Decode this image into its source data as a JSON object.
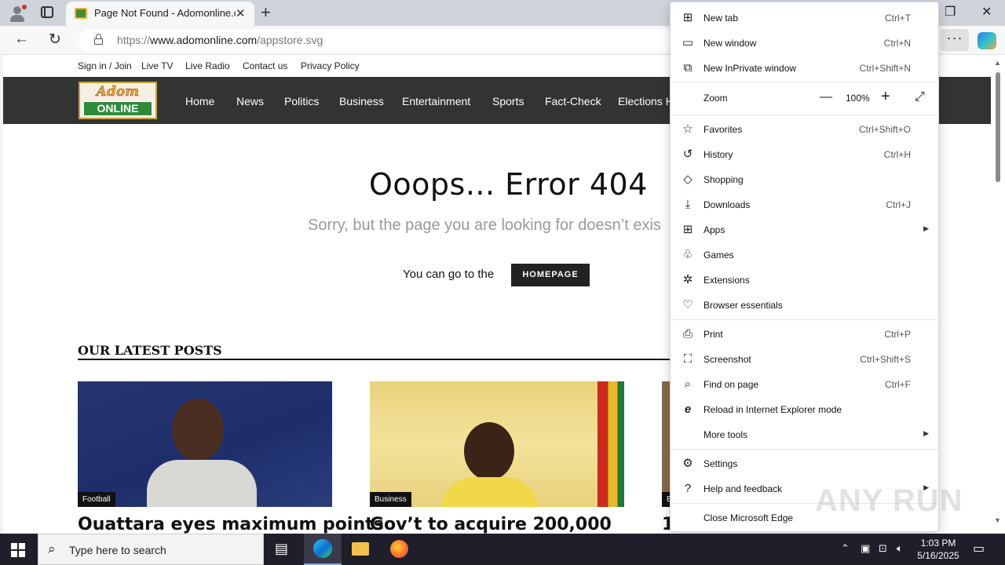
{
  "browser": {
    "tab_title": "Page Not Found - Adomonline.c",
    "url_prefix": "https://",
    "url_host": "www.adomonline.com",
    "url_path": "/appstore.svg"
  },
  "site": {
    "top_links": [
      "Sign in / Join",
      "Live TV",
      "Live Radio",
      "Contact us",
      "Privacy Policy"
    ],
    "logo_top": "Adom",
    "logo_bottom": "ONLINE",
    "nav": [
      "Home",
      "News",
      "Politics",
      "Business",
      "Entertainment",
      "Sports",
      "Fact-Check",
      "Elections H"
    ],
    "error_title": "Ooops... Error 404",
    "error_sub": "Sorry, but the page you are looking for doesn’t exis",
    "goto_text": "You can go to the",
    "homepage_btn": "HOMEPAGE",
    "latest_title": "OUR LATEST POSTS",
    "posts": [
      {
        "category": "Football",
        "title": "Ouattara eyes maximum points"
      },
      {
        "category": "Business",
        "title": "Gov’t to acquire 200,000"
      },
      {
        "category": "B",
        "title": "1"
      }
    ]
  },
  "menu": {
    "items": [
      {
        "label": "New tab",
        "shortcut": "Ctrl+T"
      },
      {
        "label": "New window",
        "shortcut": "Ctrl+N"
      },
      {
        "label": "New InPrivate window",
        "shortcut": "Ctrl+Shift+N"
      },
      {
        "label": "Zoom",
        "shortcut": ""
      },
      {
        "label": "Favorites",
        "shortcut": "Ctrl+Shift+O"
      },
      {
        "label": "History",
        "shortcut": "Ctrl+H"
      },
      {
        "label": "Shopping",
        "shortcut": ""
      },
      {
        "label": "Downloads",
        "shortcut": "Ctrl+J"
      },
      {
        "label": "Apps",
        "shortcut": ""
      },
      {
        "label": "Games",
        "shortcut": ""
      },
      {
        "label": "Extensions",
        "shortcut": ""
      },
      {
        "label": "Browser essentials",
        "shortcut": ""
      },
      {
        "label": "Print",
        "shortcut": "Ctrl+P"
      },
      {
        "label": "Screenshot",
        "shortcut": "Ctrl+Shift+S"
      },
      {
        "label": "Find on page",
        "shortcut": "Ctrl+F"
      },
      {
        "label": "Reload in Internet Explorer mode",
        "shortcut": ""
      },
      {
        "label": "More tools",
        "shortcut": ""
      },
      {
        "label": "Settings",
        "shortcut": ""
      },
      {
        "label": "Help and feedback",
        "shortcut": ""
      },
      {
        "label": "Close Microsoft Edge",
        "shortcut": ""
      }
    ],
    "zoom_value": "100%"
  },
  "watermark": "ANY RUN",
  "taskbar": {
    "search_placeholder": "Type here to search",
    "time": "1:03 PM",
    "date": "5/16/2025"
  }
}
